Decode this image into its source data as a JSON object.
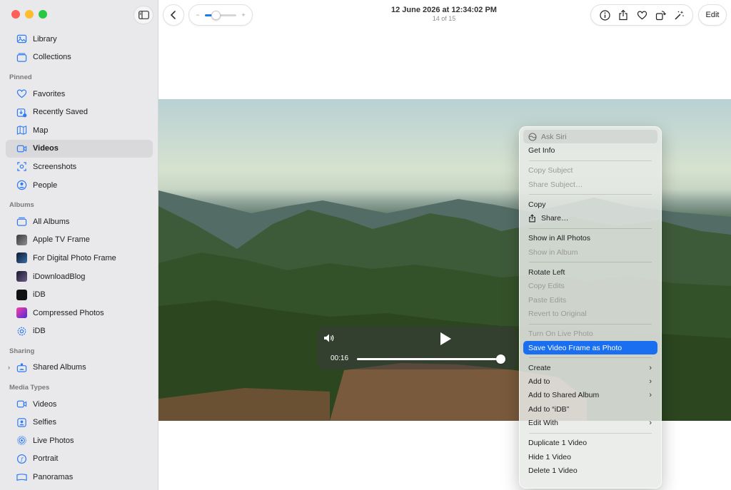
{
  "sidebar": {
    "top_items": [
      {
        "label": "Library",
        "icon": "library-icon"
      },
      {
        "label": "Collections",
        "icon": "collections-icon"
      }
    ],
    "sections": [
      {
        "title": "Pinned",
        "items": [
          {
            "label": "Favorites",
            "icon": "heart-icon"
          },
          {
            "label": "Recently Saved",
            "icon": "recently-saved-icon"
          },
          {
            "label": "Map",
            "icon": "map-icon"
          },
          {
            "label": "Videos",
            "icon": "video-icon",
            "selected": true
          },
          {
            "label": "Screenshots",
            "icon": "screenshot-icon"
          },
          {
            "label": "People",
            "icon": "person-icon"
          }
        ]
      },
      {
        "title": "Albums",
        "items": [
          {
            "label": "All Albums",
            "icon": "albums-icon"
          },
          {
            "label": "Apple TV Frame",
            "icon": "album-thumbnail-icon"
          },
          {
            "label": "For Digital Photo Frame",
            "icon": "album-thumbnail-icon"
          },
          {
            "label": "iDownloadBlog",
            "icon": "album-thumbnail-icon"
          },
          {
            "label": "iDB",
            "icon": "album-thumbnail-icon"
          },
          {
            "label": "Compressed Photos",
            "icon": "album-thumbnail-icon"
          },
          {
            "label": "iDB",
            "icon": "gear-icon"
          }
        ]
      },
      {
        "title": "Sharing",
        "items": [
          {
            "label": "Shared Albums",
            "icon": "shared-albums-icon"
          }
        ]
      },
      {
        "title": "Media Types",
        "items": [
          {
            "label": "Videos",
            "icon": "video-icon"
          },
          {
            "label": "Selfies",
            "icon": "selfie-icon"
          },
          {
            "label": "Live Photos",
            "icon": "live-photo-icon"
          },
          {
            "label": "Portrait",
            "icon": "portrait-icon"
          },
          {
            "label": "Panoramas",
            "icon": "panorama-icon"
          }
        ]
      }
    ]
  },
  "toolbar": {
    "title": "12 June 2026 at 12:34:02 PM",
    "subtitle": "14 of 15",
    "edit_label": "Edit",
    "zoom_minus": "−",
    "zoom_plus": "+",
    "zoom_level": 0.35
  },
  "video": {
    "time": "00:16",
    "progress": 0.99
  },
  "menu": {
    "ask_siri": "Ask Siri",
    "get_info": "Get Info",
    "copy_subject": "Copy Subject",
    "share_subject": "Share Subject…",
    "copy": "Copy",
    "share": "Share…",
    "show_in_all_photos": "Show in All Photos",
    "show_in_album": "Show in Album",
    "rotate_left": "Rotate Left",
    "copy_edits": "Copy Edits",
    "paste_edits": "Paste Edits",
    "revert_to_original": "Revert to Original",
    "turn_on_live_photo": "Turn On Live Photo",
    "save_video_frame": "Save Video Frame as Photo",
    "create": "Create",
    "add_to": "Add to",
    "add_to_shared_album": "Add to Shared Album",
    "add_to_idb": "Add to “iDB”",
    "edit_with": "Edit With",
    "duplicate": "Duplicate 1 Video",
    "hide": "Hide 1 Video",
    "delete": "Delete 1 Video"
  },
  "colors": {
    "accent": "#1a6ff0",
    "sidebar_icon": "#2f7cf6"
  }
}
